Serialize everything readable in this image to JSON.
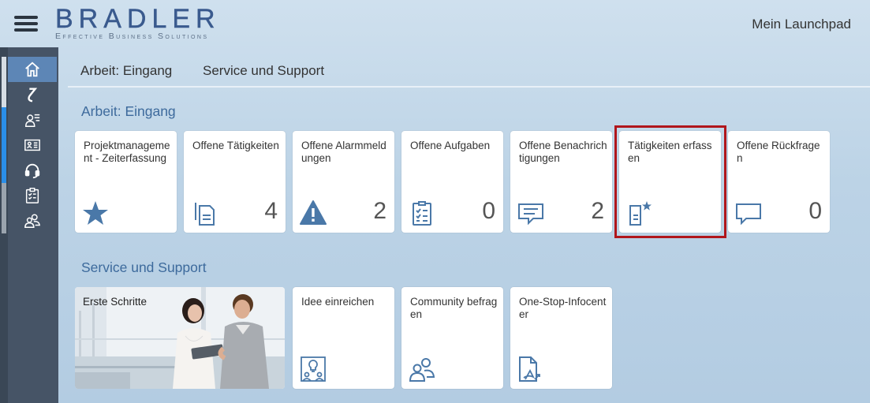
{
  "header": {
    "logo_main": "BRADLER",
    "logo_sub": "Effective Business Solutions",
    "title": "Mein Launchpad"
  },
  "sidebar": {
    "items": [
      {
        "icon": "home-icon",
        "active": true
      },
      {
        "icon": "refresh-arrow-icon"
      },
      {
        "icon": "user-list-icon"
      },
      {
        "icon": "id-card-icon"
      },
      {
        "icon": "headset-icon"
      },
      {
        "icon": "clipboard-checklist-icon"
      },
      {
        "icon": "group-icon"
      }
    ]
  },
  "tabs": [
    "Arbeit: Eingang",
    "Service und Support"
  ],
  "sections": [
    {
      "title": "Arbeit: Eingang",
      "tiles": [
        {
          "title": "Projektmanagement - Zeiterfassung",
          "icon": "star-icon",
          "count": ""
        },
        {
          "title": "Offene Tätigkeiten",
          "icon": "documents-icon",
          "count": "4"
        },
        {
          "title": "Offene Alarmmeldungen",
          "icon": "warning-icon",
          "count": "2"
        },
        {
          "title": "Offene Aufgaben",
          "icon": "task-list-icon",
          "count": "0"
        },
        {
          "title": "Offene Benachrichtigungen",
          "icon": "message-icon",
          "count": "2"
        },
        {
          "title": "Tätigkeiten erfassen",
          "icon": "document-star-icon",
          "count": ""
        },
        {
          "title": "Offene Rückfragen",
          "icon": "speech-bubble-icon",
          "count": "0"
        }
      ]
    },
    {
      "title": "Service und Support",
      "tiles": [
        {
          "title": "Erste Schritte",
          "icon": "photo"
        },
        {
          "title": "Idee einreichen",
          "icon": "idea-group-icon"
        },
        {
          "title": "Community befragen",
          "icon": "community-icon"
        },
        {
          "title": "One-Stop-Infocenter",
          "icon": "pdf-document-icon"
        }
      ]
    }
  ],
  "colors": {
    "accent": "#3d6a9c",
    "highlight": "#b0161c",
    "sidebar": "#465466",
    "active": "#5d86b6"
  }
}
